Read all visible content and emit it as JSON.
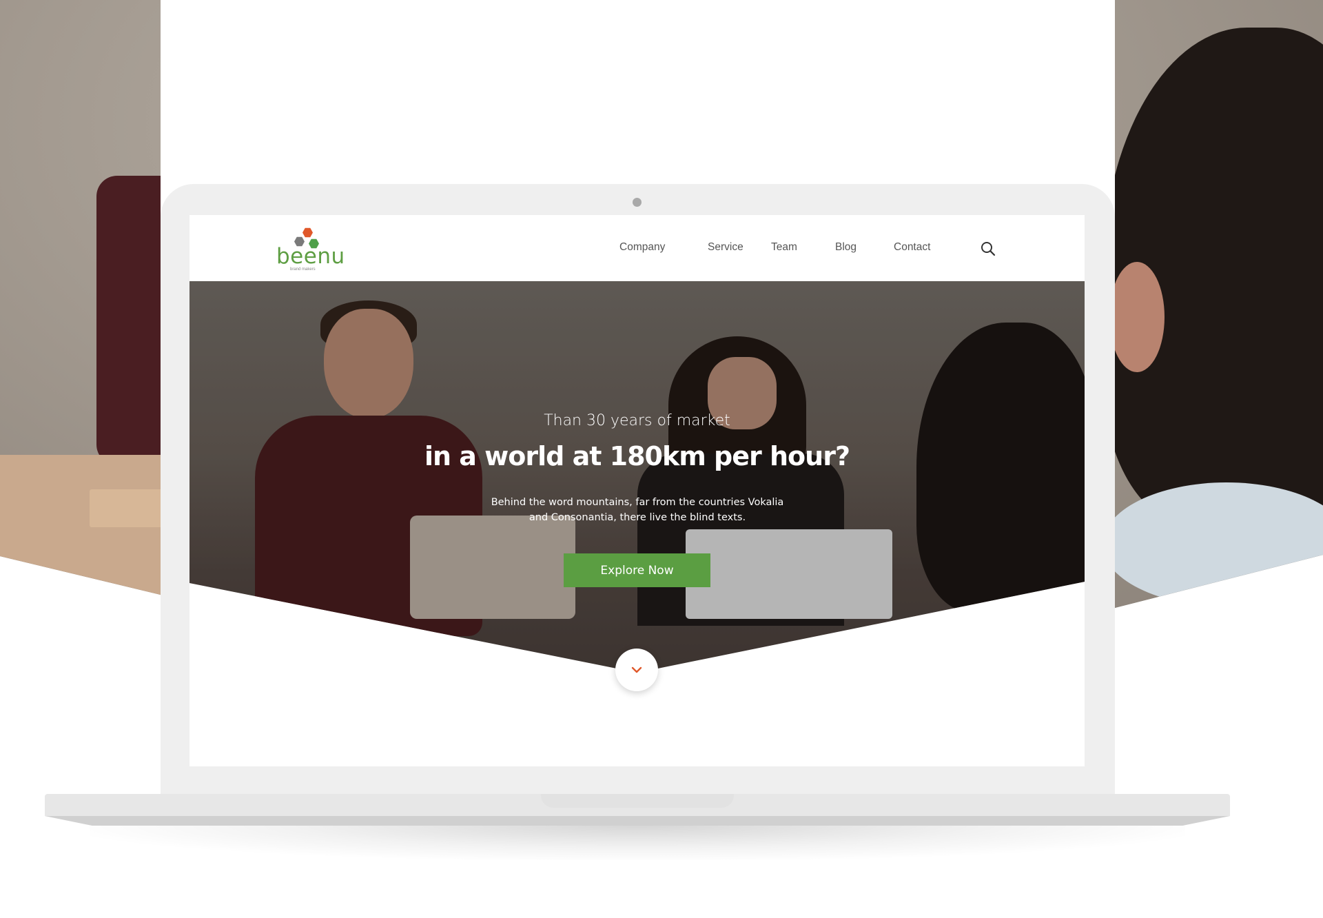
{
  "brand": {
    "name": "beenu",
    "tagline": "brand makers",
    "colors": {
      "green": "#5b9e42",
      "orange": "#e0582a",
      "gray": "#7a7a7a"
    }
  },
  "nav": {
    "items": [
      {
        "label": "Company"
      },
      {
        "label": "Service"
      },
      {
        "label": "Team"
      },
      {
        "label": "Blog"
      },
      {
        "label": "Contact"
      }
    ],
    "search_icon": "search-icon"
  },
  "hero": {
    "subtitle": "Than 30 years of market",
    "title": "in a world at 180km per hour?",
    "description_line1": "Behind the word mountains, far from the countries Vokalia",
    "description_line2": "and Consonantia, there live the blind texts.",
    "cta_label": "Explore Now",
    "scroll_icon": "chevron-down-icon"
  }
}
